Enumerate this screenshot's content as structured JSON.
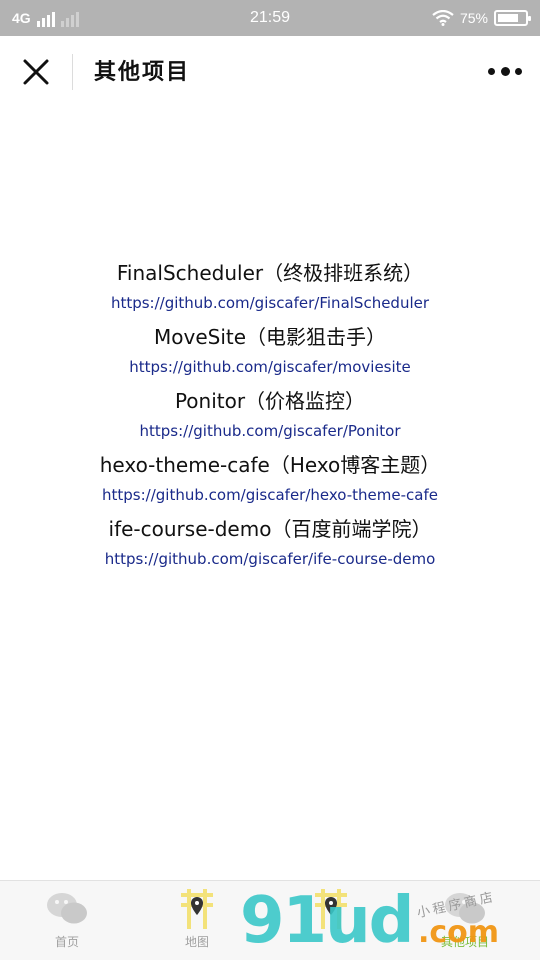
{
  "status_bar": {
    "network": "4G",
    "time": "21:59",
    "battery_percent": "75%",
    "battery_level": 0.75
  },
  "nav": {
    "title": "其他项目",
    "close_icon": "close-icon",
    "more_icon": "more-dots-icon"
  },
  "projects": [
    {
      "title": "FinalScheduler（终极排班系统）",
      "url": "https://github.com/giscafer/FinalScheduler"
    },
    {
      "title": "MoveSite（电影狙击手）",
      "url": "https://github.com/giscafer/moviesite"
    },
    {
      "title": "Ponitor（价格监控）",
      "url": "https://github.com/giscafer/Ponitor"
    },
    {
      "title": "hexo-theme-cafe（Hexo博客主题）",
      "url": "https://github.com/giscafer/hexo-theme-cafe"
    },
    {
      "title": "ife-course-demo（百度前端学院）",
      "url": "https://github.com/giscafer/ife-course-demo"
    }
  ],
  "tabs": [
    {
      "label": "首页",
      "icon": "chat-bubbles-icon",
      "active": false
    },
    {
      "label": "地图",
      "icon": "map-pin-icon",
      "active": false
    },
    {
      "label": "",
      "icon": "map-pin-icon",
      "active": false
    },
    {
      "label": "其他项目",
      "icon": "chat-bubbles-icon",
      "active": true
    }
  ],
  "watermark": {
    "main": "91ud",
    "suffix": ".com",
    "sub": "小程序商店"
  },
  "colors": {
    "status_bar_bg": "#b3b3b3",
    "link": "#1a2a8a",
    "tab_active": "#7bbd3a",
    "tab_inactive": "#a0a0a0"
  }
}
